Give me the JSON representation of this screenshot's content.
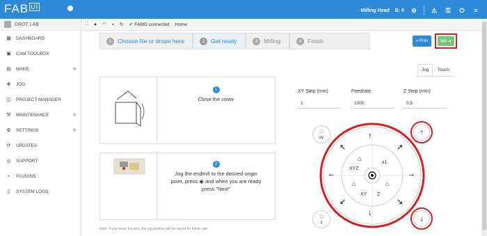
{
  "app": {
    "logo": "FAB",
    "logo_suffix": "UI"
  },
  "topbar": {
    "head": "Milling Head",
    "coords": "B: 0"
  },
  "sidebar": {
    "user": "DROT LAB",
    "items": [
      {
        "label": "DASHBOARD",
        "icon": "dashboard-icon"
      },
      {
        "label": "CAM TOOLBOX",
        "icon": "toolbox-icon"
      },
      {
        "label": "MAKE",
        "icon": "make-icon",
        "expandable": true
      },
      {
        "label": "JOG",
        "icon": "jog-icon"
      },
      {
        "label": "PROJECT MANAGER",
        "icon": "project-icon"
      },
      {
        "label": "MAINTENANCE",
        "icon": "wrench-icon",
        "expandable": true
      },
      {
        "label": "SETTINGS",
        "icon": "gear-icon",
        "expandable": true
      },
      {
        "label": "UPDATES",
        "icon": "refresh-icon"
      },
      {
        "label": "SUPPORT",
        "icon": "lifebuoy-icon"
      },
      {
        "label": "PLUGINS",
        "icon": "plug-icon"
      },
      {
        "label": "SYSTEM LOGS",
        "icon": "file-icon"
      }
    ]
  },
  "ribbon": {
    "status": "FABID connected",
    "home": "Home"
  },
  "steps": [
    {
      "num": "1",
      "label": "Choose file or drope here"
    },
    {
      "num": "2",
      "label": "Get ready"
    },
    {
      "num": "3",
      "label": "Milling"
    },
    {
      "num": "4",
      "label": "Finish"
    }
  ],
  "buttons": {
    "prev": "« Prev",
    "mill": "Mill ➜"
  },
  "tabs": {
    "jog": "Jog",
    "touch": "Touch"
  },
  "panels": [
    {
      "num": "1",
      "msg": "Close the cover"
    },
    {
      "num": "2",
      "msg": "Jog the endmill to the desired origin point, press ◉ and when you are ready press \"Next\""
    }
  ],
  "form": {
    "xy_step": {
      "label": "XY Step (mm)",
      "value": "1"
    },
    "feedrate": {
      "label": "Feedrate",
      "value": "1000"
    },
    "z_step": {
      "label": "Z Step (mm)",
      "value": "0.5"
    }
  },
  "jog": {
    "xyz": "XYZ",
    "x1": "x1",
    "xy": "XY",
    "z": "Z",
    "side_xy": "xy",
    "side_z": "z"
  },
  "note": "Note: if you home the axis, the jog position will be saved for future use",
  "colors": {
    "primary": "#2c8ad8",
    "highlight": "#d32020",
    "mill": "#7cc47c"
  }
}
